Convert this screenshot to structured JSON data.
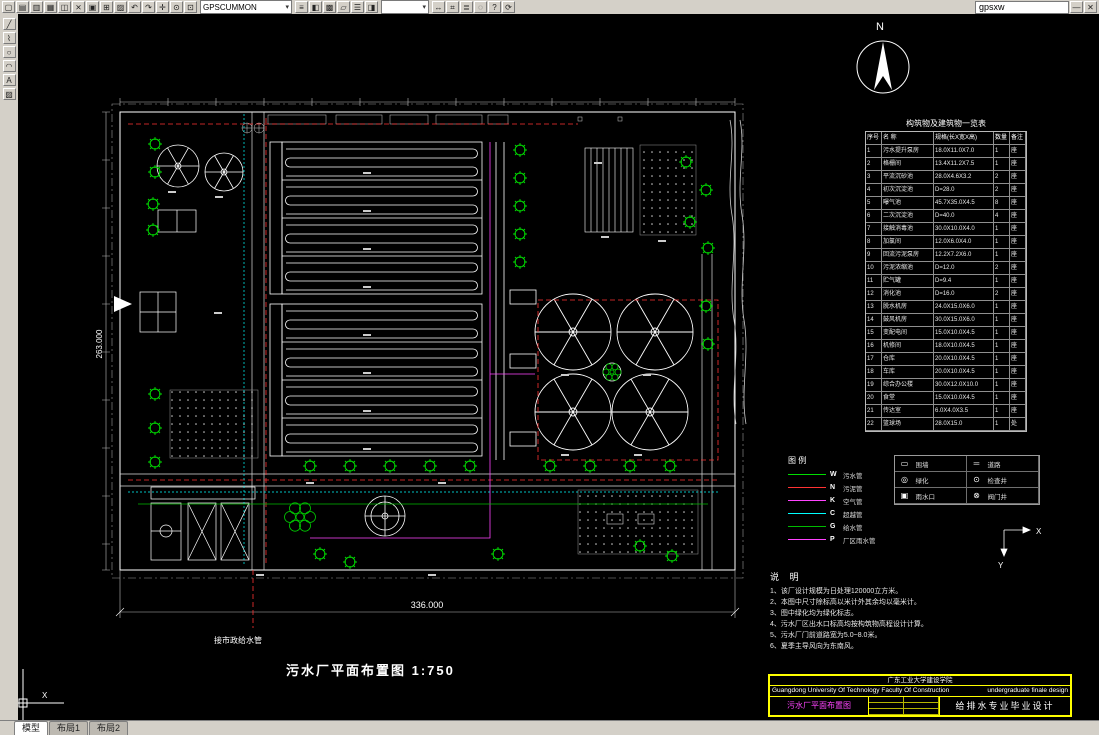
{
  "toolbar": {
    "icons_a": [
      {
        "name": "new-icon",
        "glyph": "▢"
      },
      {
        "name": "open-icon",
        "glyph": "▤"
      },
      {
        "name": "save-icon",
        "glyph": "▥"
      },
      {
        "name": "print-icon",
        "glyph": "▦"
      },
      {
        "name": "print-preview-icon",
        "glyph": "◫"
      },
      {
        "name": "cut-icon",
        "glyph": "⨯"
      },
      {
        "name": "copy-icon",
        "glyph": "▣"
      },
      {
        "name": "paste-icon",
        "glyph": "⊞"
      },
      {
        "name": "match-properties-icon",
        "glyph": "▨"
      },
      {
        "name": "undo-icon",
        "glyph": "↶"
      },
      {
        "name": "redo-icon",
        "glyph": "↷"
      },
      {
        "name": "pan-icon",
        "glyph": "✛"
      },
      {
        "name": "zoom-realtime-icon",
        "glyph": "⊙"
      },
      {
        "name": "zoom-window-icon",
        "glyph": "⊡"
      }
    ],
    "layer_combo": "GPSCUMMON",
    "icons_b": [
      {
        "name": "layers-icon",
        "glyph": "≡"
      },
      {
        "name": "layer-state-icon",
        "glyph": "◧"
      },
      {
        "name": "color-control-icon",
        "glyph": "▩"
      },
      {
        "name": "linetype-icon",
        "glyph": "▱"
      },
      {
        "name": "lineweight-icon",
        "glyph": "☰"
      },
      {
        "name": "properties-icon",
        "glyph": "◨"
      }
    ],
    "combo2": "",
    "icons_c": [
      {
        "name": "distance-icon",
        "glyph": "↔"
      },
      {
        "name": "area-icon",
        "glyph": "⌗"
      },
      {
        "name": "list-icon",
        "glyph": "≣"
      },
      {
        "name": "locate-point-icon",
        "glyph": "◌"
      },
      {
        "name": "help-icon",
        "glyph": "?"
      },
      {
        "name": "redraw-icon",
        "glyph": "⟳"
      }
    ],
    "title_field": "gpsxw",
    "icons_d": [
      {
        "name": "minimize-icon",
        "glyph": "—"
      },
      {
        "name": "close-icon",
        "glyph": "✕"
      }
    ]
  },
  "left_toolbar": {
    "icons": [
      {
        "name": "line-tool-icon",
        "glyph": "╱"
      },
      {
        "name": "polyline-tool-icon",
        "glyph": "⌇"
      },
      {
        "name": "circle-tool-icon",
        "glyph": "○"
      },
      {
        "name": "arc-tool-icon",
        "glyph": "◠"
      },
      {
        "name": "text-tool-icon",
        "glyph": "A"
      },
      {
        "name": "hatch-tool-icon",
        "glyph": "▨"
      }
    ]
  },
  "tabs": {
    "model": "模型",
    "layout1": "布局1",
    "layout2": "布局2"
  },
  "drawing": {
    "title": "污水厂平面布置图  1:750",
    "dim_bottom": "336.000",
    "dim_left": "263.000",
    "north_label": "N",
    "city_water_label": "接市政给水管",
    "axis_x": "X",
    "axis_y": "Y",
    "ucs_x": "X"
  },
  "structures_table": {
    "title": "构筑物及建筑物一览表",
    "headers": [
      "序号",
      "名 称",
      "规格(长X宽X高)",
      "数量",
      "备注"
    ],
    "rows": [
      {
        "no": "1",
        "name": "污水提升泵房",
        "size": "18.0X11.0X7.0",
        "qty": "1",
        "note": "座"
      },
      {
        "no": "2",
        "name": "格栅间",
        "size": "13.4X11.2X7.5",
        "qty": "1",
        "note": "座"
      },
      {
        "no": "3",
        "name": "平流沉砂池",
        "size": "28.0X4.6X3.2",
        "qty": "2",
        "note": "座"
      },
      {
        "no": "4",
        "name": "初次沉淀池",
        "size": "D=28.0",
        "qty": "2",
        "note": "座"
      },
      {
        "no": "5",
        "name": "曝气池",
        "size": "45.7X35.0X4.5",
        "qty": "8",
        "note": "座"
      },
      {
        "no": "6",
        "name": "二次沉淀池",
        "size": "D=40.0",
        "qty": "4",
        "note": "座"
      },
      {
        "no": "7",
        "name": "接触消毒池",
        "size": "30.0X10.0X4.0",
        "qty": "1",
        "note": "座"
      },
      {
        "no": "8",
        "name": "加氯间",
        "size": "12.0X6.0X4.0",
        "qty": "1",
        "note": "座"
      },
      {
        "no": "9",
        "name": "回流污泥泵房",
        "size": "12.2X7.2X6.0",
        "qty": "1",
        "note": "座"
      },
      {
        "no": "10",
        "name": "污泥浓缩池",
        "size": "D=12.0",
        "qty": "2",
        "note": "座"
      },
      {
        "no": "11",
        "name": "贮气罐",
        "size": "D=9.4",
        "qty": "1",
        "note": "座"
      },
      {
        "no": "12",
        "name": "消化池",
        "size": "D=16.0",
        "qty": "2",
        "note": "座"
      },
      {
        "no": "13",
        "name": "脱水机房",
        "size": "24.0X15.0X6.0",
        "qty": "1",
        "note": "座"
      },
      {
        "no": "14",
        "name": "鼓风机房",
        "size": "30.0X15.0X6.0",
        "qty": "1",
        "note": "座"
      },
      {
        "no": "15",
        "name": "变配电间",
        "size": "15.0X10.0X4.5",
        "qty": "1",
        "note": "座"
      },
      {
        "no": "16",
        "name": "机修间",
        "size": "18.0X10.0X4.5",
        "qty": "1",
        "note": "座"
      },
      {
        "no": "17",
        "name": "仓库",
        "size": "20.0X10.0X4.5",
        "qty": "1",
        "note": "座"
      },
      {
        "no": "18",
        "name": "车库",
        "size": "20.0X10.0X4.5",
        "qty": "1",
        "note": "座"
      },
      {
        "no": "19",
        "name": "综合办公楼",
        "size": "30.0X12.0X10.0",
        "qty": "1",
        "note": "座"
      },
      {
        "no": "20",
        "name": "食堂",
        "size": "15.0X10.0X4.5",
        "qty": "1",
        "note": "座"
      },
      {
        "no": "21",
        "name": "传达室",
        "size": "6.0X4.0X3.5",
        "qty": "1",
        "note": "座"
      },
      {
        "no": "22",
        "name": "篮球场",
        "size": "28.0X15.0",
        "qty": "1",
        "note": "处"
      }
    ]
  },
  "legend": {
    "title": "图 例",
    "pipes": [
      {
        "letter": "W",
        "label": "污水管"
      },
      {
        "letter": "N",
        "label": "污泥管"
      },
      {
        "letter": "K",
        "label": "空气管"
      },
      {
        "letter": "C",
        "label": "超越管"
      },
      {
        "letter": "G",
        "label": "给水管"
      },
      {
        "letter": "P",
        "label": "厂区雨水管"
      }
    ],
    "symbols": [
      {
        "glyph": "▭",
        "label": "围墙"
      },
      {
        "glyph": "═",
        "label": "道路"
      },
      {
        "glyph": "◎",
        "label": "绿化"
      },
      {
        "glyph": "⊙",
        "label": "检查井"
      },
      {
        "glyph": "▣",
        "label": "雨水口"
      },
      {
        "glyph": "⊗",
        "label": "阀门井"
      }
    ]
  },
  "notes": {
    "title": "说 明",
    "items": [
      "1、该厂设计规模为日处理120000立方米。",
      "2、本图中尺寸除标高以米计外其余均以毫米计。",
      "3、图中绿化均为绿化标志。",
      "4、污水厂区出水口标高均按构筑物高程设计计算。",
      "5、污水厂门前道路宽为5.0~8.0米。",
      "6、夏季主导风向为东南风。"
    ]
  },
  "title_block": {
    "school_cn": "广东工业大学建设学院",
    "school_en": "Guangdong University Of Technology Faculty Of Construction",
    "project_en": "undergraduate finale design",
    "drawing_name": "污水厂平面布置图",
    "major": "给排水专业毕业设计"
  },
  "colors": {
    "canvas_bg": "#000000",
    "chrome": "#d4d0c8",
    "line_white": "#ffffff",
    "tree_green": "#00dd00",
    "pipe_red": "#ff3333",
    "pipe_magenta": "#ff44ff",
    "pipe_cyan": "#00ffff",
    "titleblock_yellow": "#ffff00"
  }
}
